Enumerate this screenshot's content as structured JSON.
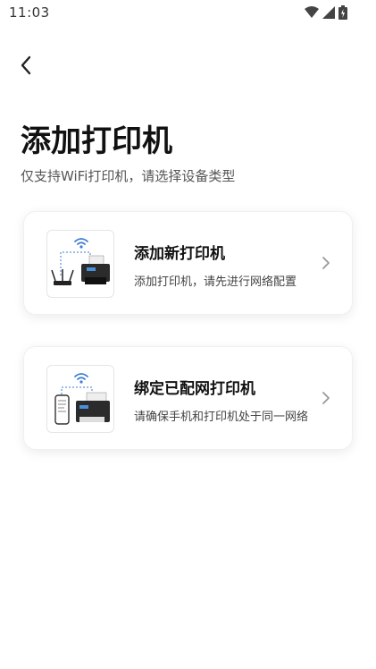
{
  "status_bar": {
    "time": "11:03",
    "icons": [
      "wifi-icon",
      "signal-icon",
      "battery-icon"
    ]
  },
  "header": {
    "back_icon": "chevron-left-icon",
    "title": "添加打印机",
    "subtitle": "仅支持WiFi打印机，请选择设备类型"
  },
  "options": [
    {
      "title": "添加新打印机",
      "description": "添加打印机，请先进行网络配置",
      "icon": "printer-router-illustration"
    },
    {
      "title": "绑定已配网打印机",
      "description": "请确保手机和打印机处于同一网络",
      "icon": "printer-phone-illustration"
    }
  ],
  "colors": {
    "background": "#ffffff",
    "title": "#111111",
    "subtitle": "#555555",
    "chevron": "#999999",
    "wifi_accent": "#3a7bd5"
  }
}
